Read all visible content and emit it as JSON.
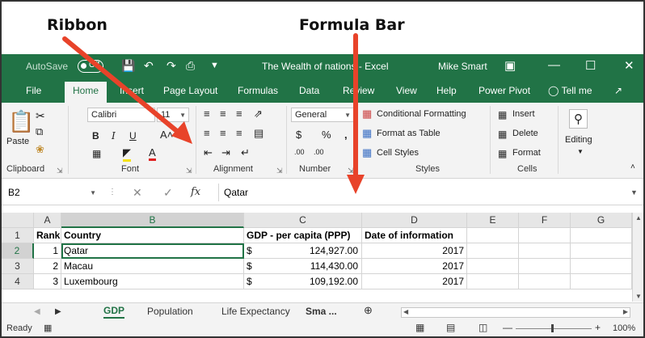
{
  "annotations": {
    "ribbon_label": "Ribbon",
    "formula_bar_label": "Formula Bar"
  },
  "titlebar": {
    "autosave": "AutoSave",
    "autosave_state": "Off",
    "document": "The Wealth of nations - Excel",
    "user": "Mike Smart"
  },
  "menu": {
    "tabs": [
      "File",
      "Home",
      "Insert",
      "Page Layout",
      "Formulas",
      "Data",
      "Review",
      "View",
      "Help",
      "Power Pivot"
    ],
    "tell_me": "Tell me"
  },
  "ribbon": {
    "clipboard": {
      "label": "Clipboard",
      "paste": "Paste"
    },
    "font": {
      "label": "Font",
      "family": "Calibri",
      "size": "11",
      "bold": "B",
      "italic": "I",
      "underline": "U"
    },
    "alignment": {
      "label": "Alignment"
    },
    "number": {
      "label": "Number",
      "format": "General",
      "currency": "$",
      "percent": "%",
      "comma": ",",
      "inc_decimal": ".00",
      "dec_decimal": ".00"
    },
    "styles": {
      "label": "Styles",
      "conditional": "Conditional Formatting",
      "table": "Format as Table",
      "cell": "Cell Styles"
    },
    "cells": {
      "label": "Cells",
      "insert": "Insert",
      "delete": "Delete",
      "format": "Format"
    },
    "editing": {
      "label": "Editing"
    }
  },
  "formula_bar": {
    "name_box": "B2",
    "fx": "fx",
    "value": "Qatar"
  },
  "sheet": {
    "columns": [
      "A",
      "B",
      "C",
      "D",
      "E",
      "F",
      "G"
    ],
    "header_row": {
      "num": "1",
      "rank": "Rank",
      "country": "Country",
      "gdp": "GDP - per capita (PPP)",
      "date": "Date of information"
    },
    "rows": [
      {
        "num": "2",
        "rank": "1",
        "country": "Qatar",
        "currency": "$",
        "gdp": "124,927.00",
        "date": "2017"
      },
      {
        "num": "3",
        "rank": "2",
        "country": "Macau",
        "currency": "$",
        "gdp": "114,430.00",
        "date": "2017"
      },
      {
        "num": "4",
        "rank": "3",
        "country": "Luxembourg",
        "currency": "$",
        "gdp": "109,192.00",
        "date": "2017"
      }
    ]
  },
  "sheet_tabs": [
    "GDP",
    "Population",
    "Life Expectancy",
    "Sma ..."
  ],
  "status": {
    "ready": "Ready",
    "zoom": "100%"
  },
  "colors": {
    "accent": "#217346",
    "arrow": "#e8432a"
  }
}
